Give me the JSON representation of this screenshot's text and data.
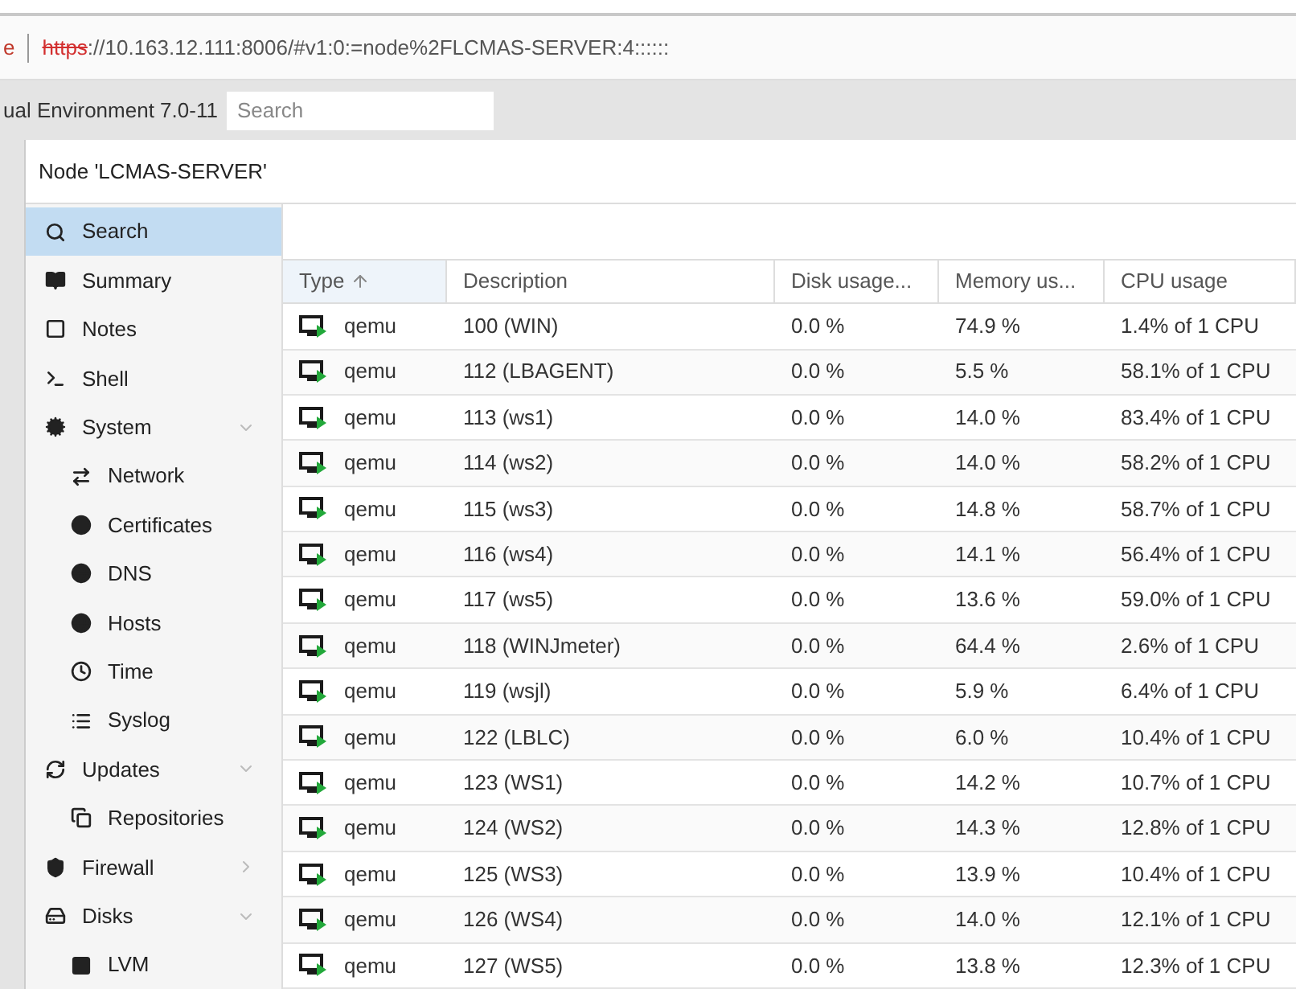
{
  "address_bar": {
    "prefix": "e",
    "scheme": "https",
    "rest": "://10.163.12.111:8006/#v1:0:=node%2FLCMAS-SERVER:4::::::"
  },
  "header": {
    "product": "ual Environment 7.0-11",
    "search": {
      "placeholder": "Search"
    }
  },
  "panel": {
    "title": "Node 'LCMAS-SERVER'"
  },
  "sidebar": {
    "items": [
      {
        "label": "Search",
        "selected": true
      },
      {
        "label": "Summary",
        "selected": false
      },
      {
        "label": "Notes",
        "selected": false
      },
      {
        "label": "Shell",
        "selected": false
      },
      {
        "label": "System",
        "selected": false,
        "expanded": true,
        "children": [
          {
            "label": "Network",
            "selected": false
          },
          {
            "label": "Certificates",
            "selected": false
          },
          {
            "label": "DNS",
            "selected": false
          },
          {
            "label": "Hosts",
            "selected": false
          },
          {
            "label": "Time",
            "selected": false
          },
          {
            "label": "Syslog",
            "selected": false
          }
        ]
      },
      {
        "label": "Updates",
        "selected": false,
        "expanded": true,
        "children": [
          {
            "label": "Repositories",
            "selected": false
          }
        ]
      },
      {
        "label": "Firewall",
        "selected": false,
        "expanded": false
      },
      {
        "label": "Disks",
        "selected": false,
        "expanded": true,
        "children": [
          {
            "label": "LVM",
            "selected": false
          }
        ]
      }
    ]
  },
  "table": {
    "columns": [
      {
        "label": "Type",
        "sorted": true
      },
      {
        "label": "Description",
        "sorted": false
      },
      {
        "label": "Disk usage...",
        "sorted": false
      },
      {
        "label": "Memory us...",
        "sorted": false
      },
      {
        "label": "CPU usage",
        "sorted": false
      }
    ],
    "rows": [
      [
        "qemu",
        "100 (WIN)",
        "0.0 %",
        "74.9 %",
        "1.4% of 1 CPU"
      ],
      [
        "qemu",
        "112 (LBAGENT)",
        "0.0 %",
        "5.5 %",
        "58.1% of 1 CPU"
      ],
      [
        "qemu",
        "113 (ws1)",
        "0.0 %",
        "14.0 %",
        "83.4% of 1 CPU"
      ],
      [
        "qemu",
        "114 (ws2)",
        "0.0 %",
        "14.0 %",
        "58.2% of 1 CPU"
      ],
      [
        "qemu",
        "115 (ws3)",
        "0.0 %",
        "14.8 %",
        "58.7% of 1 CPU"
      ],
      [
        "qemu",
        "116 (ws4)",
        "0.0 %",
        "14.1 %",
        "56.4% of 1 CPU"
      ],
      [
        "qemu",
        "117 (ws5)",
        "0.0 %",
        "13.6 %",
        "59.0% of 1 CPU"
      ],
      [
        "qemu",
        "118 (WINJmeter)",
        "0.0 %",
        "64.4 %",
        "2.6% of 1 CPU"
      ],
      [
        "qemu",
        "119 (wsjl)",
        "0.0 %",
        "5.9 %",
        "6.4% of 1 CPU"
      ],
      [
        "qemu",
        "122 (LBLC)",
        "0.0 %",
        "6.0 %",
        "10.4% of 1 CPU"
      ],
      [
        "qemu",
        "123 (WS1)",
        "0.0 %",
        "14.2 %",
        "10.7% of 1 CPU"
      ],
      [
        "qemu",
        "124 (WS2)",
        "0.0 %",
        "14.3 %",
        "12.8% of 1 CPU"
      ],
      [
        "qemu",
        "125 (WS3)",
        "0.0 %",
        "13.9 %",
        "10.4% of 1 CPU"
      ],
      [
        "qemu",
        "126 (WS4)",
        "0.0 %",
        "14.0 %",
        "12.1% of 1 CPU"
      ],
      [
        "qemu",
        "127 (WS5)",
        "0.0 %",
        "13.8 %",
        "12.3% of 1 CPU"
      ]
    ]
  }
}
